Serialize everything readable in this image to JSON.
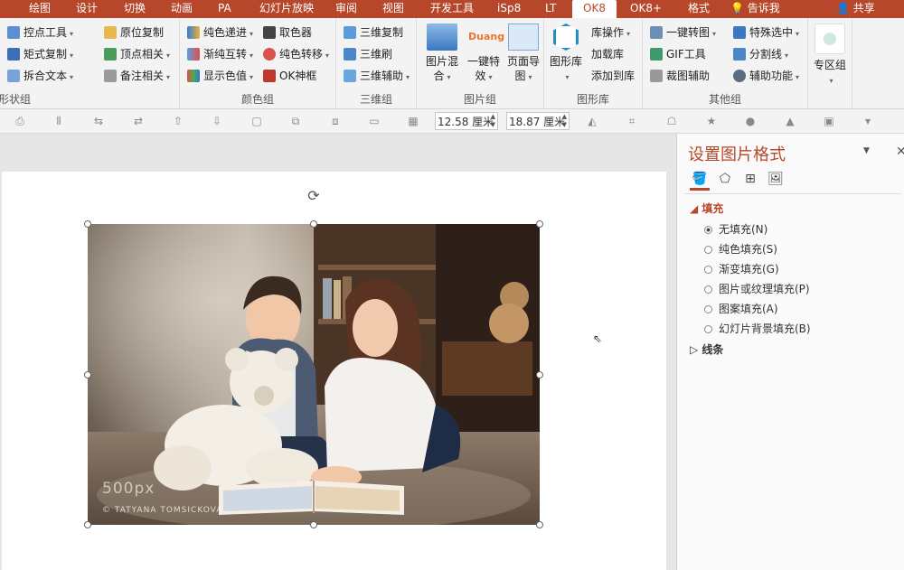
{
  "tabs": [
    "绘图",
    "设计",
    "切换",
    "动画",
    "PA",
    "幻灯片放映",
    "审阅",
    "视图",
    "开发工具",
    "iSp8",
    "LT",
    "OK8",
    "OK8+",
    "格式"
  ],
  "active_tab": "OK8",
  "tell_me": "告诉我",
  "share": "共享",
  "ribbon": {
    "group1": {
      "label": "形状组",
      "items": [
        "控点工具",
        "矩式复制",
        "拆合文本",
        "原位复制",
        "顶点相关",
        "备注相关"
      ]
    },
    "group2": {
      "label": "颜色组",
      "items": [
        "纯色递进",
        "渐纯互转",
        "显示色值",
        "取色器",
        "纯色转移",
        "OK神框"
      ]
    },
    "group3": {
      "label": "三维组",
      "items": [
        "三维复制",
        "三维刷",
        "三维辅助"
      ]
    },
    "group4": {
      "label": "图片组",
      "items": [
        "图片混合",
        "一键特效",
        "页面导图"
      ],
      "duang": "Duang"
    },
    "group5": {
      "label": "图形库",
      "items": [
        "图形库",
        "库操作",
        "加载库",
        "添加到库"
      ]
    },
    "group6": {
      "label": "其他组",
      "items": [
        "一键转图",
        "GIF工具",
        "裁图辅助",
        "特殊选中",
        "分割线",
        "辅助功能"
      ]
    },
    "group7": {
      "label": "",
      "items": [
        "专区组"
      ]
    }
  },
  "toolbar": {
    "height_value": "12.58 厘米",
    "width_value": "18.87 厘米"
  },
  "photo": {
    "watermark_brand": "500px",
    "watermark_author": "© TATYANA TOMSICKOVA"
  },
  "pane": {
    "title": "设置图片格式",
    "fill_section": "填充",
    "options": [
      "无填充(N)",
      "纯色填充(S)",
      "渐变填充(G)",
      "图片或纹理填充(P)",
      "图案填充(A)",
      "幻灯片背景填充(B)"
    ],
    "selected_option": 0,
    "line_section": "线条"
  },
  "colors": {
    "accent": "#b7472a",
    "ribbon_bg": "#f3f3f3"
  }
}
